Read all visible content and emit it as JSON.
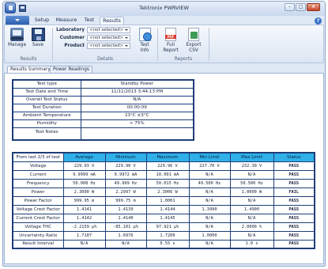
{
  "window": {
    "title": "Tektronix PWRVIEW"
  },
  "ribbon": {
    "tabs": [
      "Setup",
      "Measure",
      "Test",
      "Results"
    ],
    "active_tab": "Results",
    "buttons": {
      "manage": "Manage",
      "save": "Save",
      "test_info": [
        "Test",
        "Info"
      ],
      "full_report": [
        "Full",
        "Report"
      ],
      "export_csv": [
        "Export",
        "CSV"
      ]
    },
    "groups": {
      "results": "Results",
      "details": "Details",
      "reports": "Reports"
    },
    "details": {
      "laboratory": {
        "label": "Laboratory",
        "value": "<not selected>"
      },
      "customer": {
        "label": "Customer",
        "value": "<not selected>"
      },
      "product": {
        "label": "Product",
        "value": "<not selected>"
      }
    }
  },
  "doc_tabs": [
    "Results Summary",
    "Power Readings"
  ],
  "summary": [
    {
      "label": "Test type",
      "value": "Standby Power"
    },
    {
      "label": "Test Date and Time",
      "value": "11/11/2013 3:44:13 PM"
    },
    {
      "label": "Overall Test Status",
      "value": "N/A"
    },
    {
      "label": "Test Duration",
      "value": "00:00:09"
    },
    {
      "label": "Ambient Temperature",
      "value": "23°C ±3°C"
    },
    {
      "label": "Humidity",
      "value": "< 75%"
    },
    {
      "label": "Test Notes",
      "value": ""
    }
  ],
  "measurements": {
    "headers": [
      "From last 2/3 of test",
      "Average",
      "Minimum",
      "Maximum",
      "Min Limit",
      "Max Limit",
      "Status"
    ],
    "rows": [
      [
        "Voltage",
        "229.93 V",
        "229.90 V",
        "229.96 V",
        "227.70 V",
        "232.30 V",
        "PASS"
      ],
      [
        "Current",
        "9.9999 mA",
        "9.9972 mA",
        "10.001 mA",
        "N/A",
        "N/A",
        "PASS"
      ],
      [
        "Frequency",
        "50.008 Hz",
        "49.999 Hz",
        "50.015 Hz",
        "49.500 Hz",
        "50.500 Hz",
        "PASS"
      ],
      [
        "Power",
        "2.3000 W",
        "2.2997 W",
        "2.3006 W",
        "N/A",
        "1.0000 W",
        "FAIL"
      ],
      [
        "Power Factor",
        "999.95 m",
        "999.75 m",
        "1.0001",
        "N/A",
        "N/A",
        "PASS"
      ],
      [
        "Voltage Crest Factor",
        "1.4141",
        "1.4139",
        "1.4144",
        "1.3990",
        "1.4900",
        "PASS"
      ],
      [
        "Current Crest Factor",
        "1.4142",
        "1.4140",
        "1.4145",
        "N/A",
        "N/A",
        "PASS"
      ],
      [
        "Voltage THC",
        "-2.2159 µ%",
        "-85.101 µ%",
        "97.921 µ%",
        "N/A",
        "2.0000 %",
        "PASS"
      ],
      [
        "Uncertainty Ratio",
        "1.7107",
        "1.6976",
        "1.7200",
        "1.0000",
        "N/A",
        "PASS"
      ],
      [
        "Result Interval",
        "N/A",
        "N/A",
        "0.55 s",
        "N/A",
        "1.0 s",
        "PASS"
      ]
    ]
  },
  "colors": {
    "header_fill": "#2fb0e8",
    "table_border": "#1e3e78",
    "chrome": "#dfe8f5"
  }
}
